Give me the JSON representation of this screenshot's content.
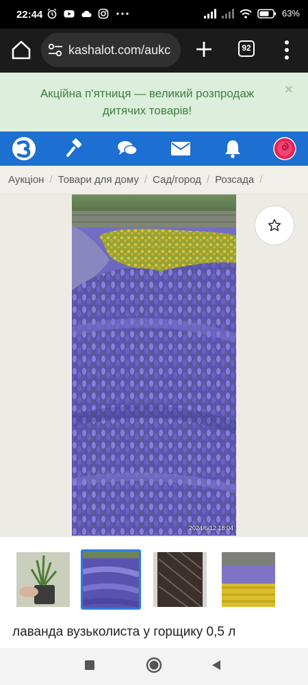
{
  "status_bar": {
    "time": "22:44",
    "battery": "63%"
  },
  "browser": {
    "url": "kashalot.com/aukc",
    "tab_count": "92"
  },
  "promo": {
    "text": "Акційна п'ятниця — великий розпродаж дитячих товарів!",
    "close": "×"
  },
  "site_nav": {
    "items": [
      "logo-icon",
      "gavel-icon",
      "chat-icon",
      "mail-icon",
      "bell-icon",
      "avatar"
    ]
  },
  "breadcrumb": {
    "items": [
      "Аукціон",
      "Товари для дому",
      "Сад/город",
      "Розсада"
    ],
    "separator": "/"
  },
  "gallery": {
    "photo_stamp": "2024/6/12 18:04",
    "thumbnails_count": 4,
    "selected_thumbnail": 2
  },
  "item": {
    "title": "лаванда вузьколиста у горщику 0,5 л"
  },
  "colors": {
    "nav_blue": "#1d6fd1",
    "promo_bg": "#dcefdc",
    "promo_text": "#3d7d3f",
    "selected_border": "#2f7ae0"
  }
}
